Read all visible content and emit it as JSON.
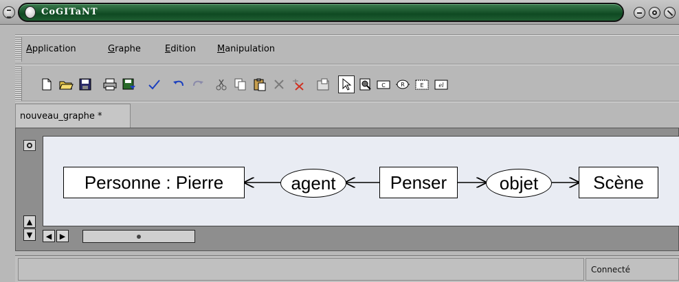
{
  "window": {
    "title": "CoGITaNT"
  },
  "menu": {
    "items": [
      {
        "label": "Application"
      },
      {
        "label": "Graphe"
      },
      {
        "label": "Edition"
      },
      {
        "label": "Manipulation"
      }
    ]
  },
  "toolbar": {
    "icons": [
      "new-file-icon",
      "open-folder-icon",
      "save-icon",
      "print-icon",
      "save-as-icon",
      "check-icon",
      "undo-icon",
      "redo-icon",
      "cut-icon",
      "copy-icon",
      "paste-icon",
      "delete-icon",
      "delete-link-icon",
      "properties-icon",
      "select-pointer-icon",
      "zoom-inspect-icon",
      "add-concept-icon",
      "add-relation-icon",
      "add-coreference-icon",
      "add-link-icon"
    ],
    "selected": "select-pointer-icon"
  },
  "tab": {
    "label": "nouveau_graphe *"
  },
  "graph": {
    "concepts": [
      "Personne : Pierre",
      "Penser",
      "Scène"
    ],
    "relations": [
      "agent",
      "objet"
    ]
  },
  "status": {
    "main": "",
    "connection": "Connecté"
  },
  "colors": {
    "title_bar_green": "#1a5a2e",
    "canvas_bg": "#e9ecf3",
    "chrome_gray": "#b8b8b8"
  }
}
